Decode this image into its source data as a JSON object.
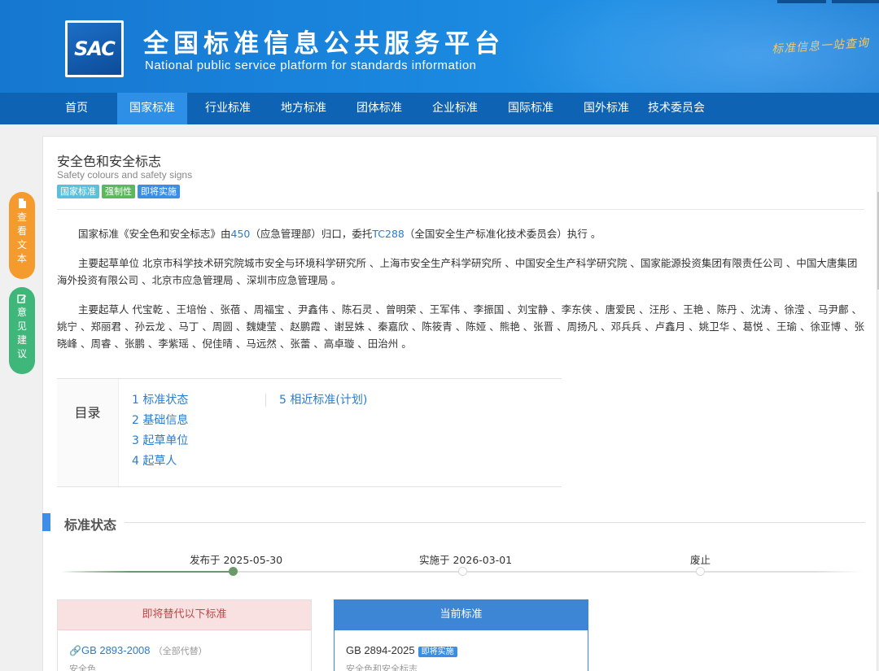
{
  "header": {
    "logo_text": "SAC",
    "title_cn": "全国标准信息公共服务平台",
    "title_en": "National public service platform  for standards information",
    "slogan": "标准信息一站查询"
  },
  "nav": {
    "items": [
      {
        "label": "首页"
      },
      {
        "label": "国家标准"
      },
      {
        "label": "行业标准"
      },
      {
        "label": "地方标准"
      },
      {
        "label": "团体标准"
      },
      {
        "label": "企业标准"
      },
      {
        "label": "国际标准"
      },
      {
        "label": "国外标准"
      },
      {
        "label": "技术委员会"
      }
    ],
    "active_index": 1
  },
  "side_buttons": {
    "view_text": [
      "查",
      "看",
      "文",
      "本"
    ],
    "feedback": [
      "意",
      "见",
      "建",
      "议"
    ]
  },
  "standard": {
    "title": "安全色和安全标志",
    "subtitle": "Safety colours and safety signs",
    "badges": [
      "国家标准",
      "强制性",
      "即将实施"
    ]
  },
  "description": {
    "p1_prefix": "国家标准《安全色和安全标志》由",
    "p1_link1": "450",
    "p1_mid": "（应急管理部）归口，委托",
    "p1_link2": "TC288",
    "p1_suffix": "（全国安全生产标准化技术委员会）执行 。",
    "p2": "主要起草单位 北京市科学技术研究院城市安全与环境科学研究所 、上海市安全生产科学研究所 、中国安全生产科学研究院 、国家能源投资集团有限责任公司 、中国大唐集团海外投资有限公司 、北京市应急管理局 、深圳市应急管理局 。",
    "p3": "主要起草人 代宝乾 、王培怡 、张蓓 、周福宝 、尹鑫伟 、陈石灵 、曾明荣 、王军伟 、李振国 、刘宝静 、李东侠 、唐爱民 、汪彤 、王艳 、陈丹 、沈涛 、徐滢 、马尹鄜 、姚宁 、郑丽君 、孙云龙 、马丁 、周圆 、魏婕莹 、赵鹏霞 、谢昱姝 、秦嘉欣 、陈筱青 、陈娅 、熊艳 、张晋 、周扬凡 、邓兵兵 、卢鑫月 、姚卫华 、葛悦 、王瑜 、徐亚博 、张晓峰 、周睿 、张鹏 、李紫瑶 、倪佳晴 、马远然 、张蕾 、高卓璇 、田治州 。"
  },
  "toc": {
    "label": "目录",
    "col1": [
      "1  标准状态",
      "2  基础信息",
      "3  起草单位",
      "4  起草人"
    ],
    "col2": [
      "5  相近标准(计划)"
    ]
  },
  "status_section": {
    "title": "标准状态",
    "timeline": [
      {
        "label": "发布于 2025-05-30",
        "done": true
      },
      {
        "label": "实施于 2026-03-01",
        "done": false
      },
      {
        "label": "废止",
        "done": false
      }
    ],
    "progress": 0.22
  },
  "cards": {
    "replace": {
      "header": "即将替代以下标准",
      "code": "GB 2893-2008",
      "note": "（全部代替）",
      "name": "安全色"
    },
    "current": {
      "header": "当前标准",
      "code": "GB 2894-2025",
      "badge": "即将实施",
      "name": "安全色和安全标志"
    }
  },
  "colors": {
    "header_blue": "#1a86de",
    "nav_blue": "#0f63b4",
    "nav_active": "#2d8fe6",
    "link_blue": "#2a7ccf",
    "side_orange": "#f59a2c",
    "side_green": "#3fb67a"
  }
}
